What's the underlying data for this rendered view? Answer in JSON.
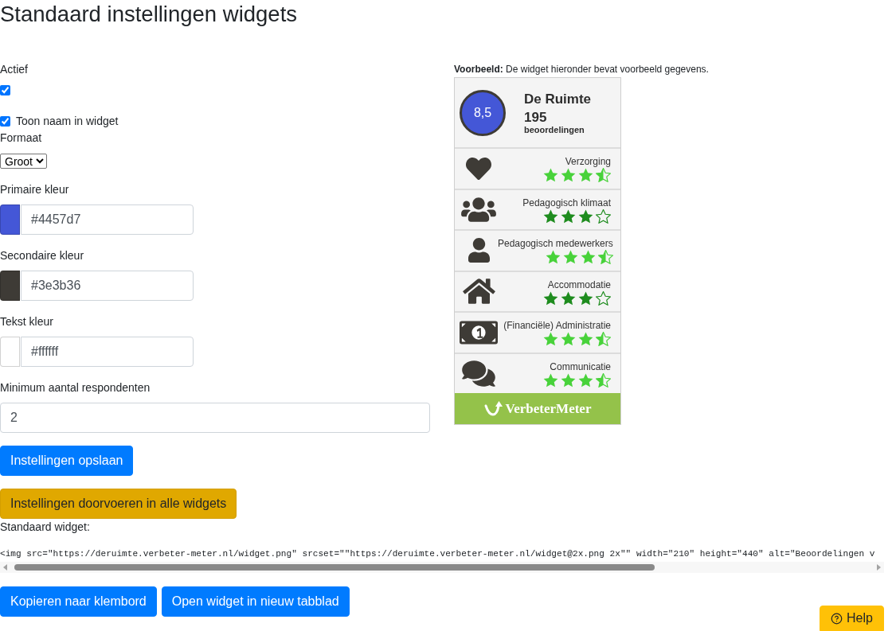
{
  "page": {
    "title": "Standaard instellingen widgets"
  },
  "form": {
    "fields": [
      {
        "kind": "checkbox",
        "label": "Actief",
        "checked": true
      },
      {
        "kind": "checkbox_inline",
        "label": "Toon naam in widget",
        "checked": true
      },
      {
        "kind": "select",
        "label": "Formaat",
        "value": "Groot"
      },
      {
        "kind": "color",
        "label": "Primaire kleur",
        "value": "#4457d7"
      },
      {
        "kind": "color",
        "label": "Secondaire kleur",
        "value": "#3e3b36"
      },
      {
        "kind": "color",
        "label": "Tekst kleur",
        "value": "#ffffff"
      },
      {
        "kind": "number",
        "label": "Minimum aantal respondenten",
        "value": "2"
      }
    ],
    "buttons": [
      {
        "kind": "primary",
        "label": "Instellingen opslaan"
      },
      {
        "kind": "warning",
        "label": "Instellingen doorvoeren in alle widgets"
      }
    ]
  },
  "preview": {
    "note": "**Voorbeeld:** De widget hieronder bevat voorbeeld gegevens.",
    "widget": {
      "score": "8,5",
      "name": "De Ruimte",
      "count": "195",
      "count_label": "beoordelingen",
      "categories": [
        {
          "label": "Verzorging",
          "stars": 3.5,
          "color": "#48d23a"
        },
        {
          "label": "Pedagogisch klimaat",
          "stars": 3,
          "color": "#1e8c1e"
        },
        {
          "label": "Pedagogisch medewerkers",
          "stars": 3.5,
          "color": "#48d23a"
        },
        {
          "label": "Accommodatie",
          "stars": 3,
          "color": "#1e8c1e"
        },
        {
          "label": "(Financiële) Administratie",
          "stars": 3.5,
          "color": "#48d23a"
        },
        {
          "label": "Communicatie",
          "stars": 3.5,
          "color": "#48d23a"
        }
      ],
      "footer": "VerbeterMeter"
    }
  },
  "embed": {
    "label": "Standaard widget:",
    "code": "<img src=\"https://deruimte.verbeter-meter.nl/widget.png\" srcset=\"\"https://deruimte.verbeter-meter.nl/widget@2x.png 2x\"\" width=\"210\" height=\"440\" alt=\"Beoordelingen v",
    "buttons": [
      "Kopieren naar klembord",
      "Open widget in nieuw tabblad"
    ]
  },
  "help_button": "Help"
}
